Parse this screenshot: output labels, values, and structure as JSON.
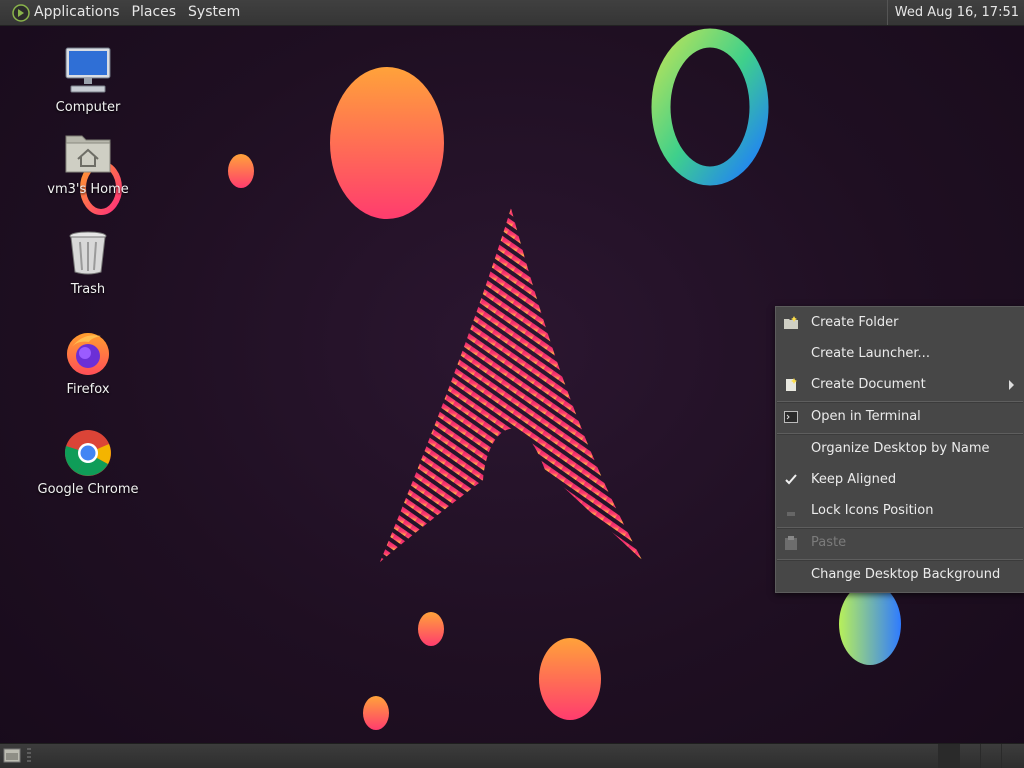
{
  "top_panel": {
    "menus": [
      "Applications",
      "Places",
      "System"
    ],
    "clock": "Wed Aug 16, 17:51"
  },
  "desktop_icons": [
    {
      "label": "Computer",
      "icon": "computer-icon"
    },
    {
      "label": "vm3's Home",
      "icon": "home-folder-icon"
    },
    {
      "label": "Trash",
      "icon": "trash-icon"
    },
    {
      "label": "Firefox",
      "icon": "firefox-icon"
    },
    {
      "label": "Google Chrome",
      "icon": "chrome-icon"
    }
  ],
  "context_menu": {
    "items": [
      {
        "label": "Create Folder",
        "icon": "new-folder-icon"
      },
      {
        "label": "Create Launcher..."
      },
      {
        "label": "Create Document",
        "icon": "new-document-icon",
        "submenu": true
      },
      {
        "label": "Open in Terminal",
        "icon": "terminal-icon"
      },
      {
        "label": "Organize Desktop by Name"
      },
      {
        "label": "Keep Aligned",
        "checked": true
      },
      {
        "label": "Lock Icons Position",
        "icon": "lock-icon"
      },
      {
        "label": "Paste",
        "icon": "paste-icon",
        "disabled": true
      },
      {
        "label": "Change Desktop Background"
      }
    ]
  },
  "colors": {
    "background": "#1f0f22",
    "panel": "#3a3a3a",
    "menu_bg": "#474747",
    "accent_orange": "#ff8a3d",
    "accent_pink": "#ff2f7a"
  }
}
